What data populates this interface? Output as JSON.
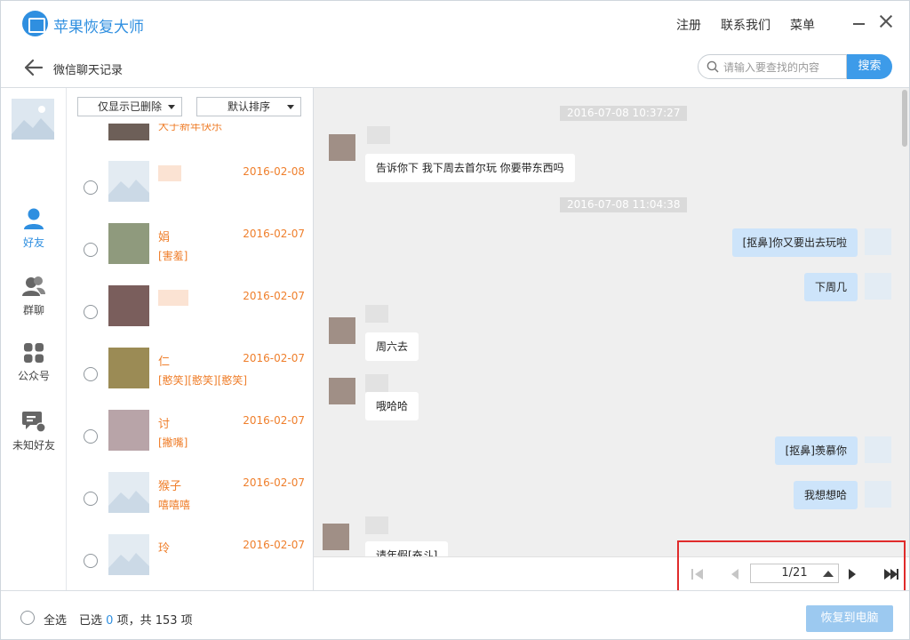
{
  "app": {
    "title": "苹果恢复大师"
  },
  "top_links": {
    "register": "注册",
    "contact": "联系我们",
    "menu": "菜单"
  },
  "header": {
    "page_title": "微信聊天记录",
    "search_placeholder": "请输入要查找的内容",
    "search_button": "搜索"
  },
  "nav": {
    "items": [
      {
        "label": "好友",
        "icon": "person-icon",
        "active": true
      },
      {
        "label": "群聊",
        "icon": "group-icon",
        "active": false
      },
      {
        "label": "公众号",
        "icon": "grid-icon",
        "active": false
      },
      {
        "label": "未知好友",
        "icon": "chat-question-icon",
        "active": false
      }
    ]
  },
  "filters": {
    "show_deleted": "仅显示已删除",
    "sort": "默认排序"
  },
  "contacts": [
    {
      "name": "",
      "date": "",
      "message": "大于新年快乐"
    },
    {
      "name": "",
      "date": "2016-02-08",
      "message": ""
    },
    {
      "name": "娟",
      "date": "2016-02-07",
      "message": "[害羞]"
    },
    {
      "name": "",
      "date": "2016-02-07",
      "message": ""
    },
    {
      "name": "仁",
      "date": "2016-02-07",
      "message": "[憨笑][憨笑][憨笑]"
    },
    {
      "name": "讨",
      "date": "2016-02-07",
      "message": "[撇嘴]"
    },
    {
      "name": "猴子",
      "date": "2016-02-07",
      "message": "嘻嘻嘻"
    },
    {
      "name": "玲",
      "date": "2016-02-07",
      "message": ""
    }
  ],
  "chat": {
    "timestamps": [
      "2016-07-08 10:37:27",
      "2016-07-08 11:04:38"
    ],
    "messages": [
      {
        "side": "in",
        "text": "告诉你下 我下周去首尔玩 你要带东西吗"
      },
      {
        "side": "out",
        "text": "[抠鼻]你又要出去玩啦"
      },
      {
        "side": "out",
        "text": "下周几"
      },
      {
        "side": "in",
        "text": "周六去"
      },
      {
        "side": "in",
        "text": "哦哈哈"
      },
      {
        "side": "out",
        "text": "[抠鼻]羡慕你"
      },
      {
        "side": "out",
        "text": "我想想哈"
      },
      {
        "side": "in",
        "text": "请年假[奋斗]"
      }
    ]
  },
  "pager": {
    "page": "1/21"
  },
  "bottom": {
    "select_all": "全选",
    "selected_prefix": "已选",
    "selected_count": "0",
    "selected_suffix": "项，共 153 项",
    "recover_button": "恢复到电脑"
  },
  "colors": {
    "accent": "#2f8fe0",
    "orange": "#ef7f2c",
    "highlight_red": "#e02b2b"
  }
}
